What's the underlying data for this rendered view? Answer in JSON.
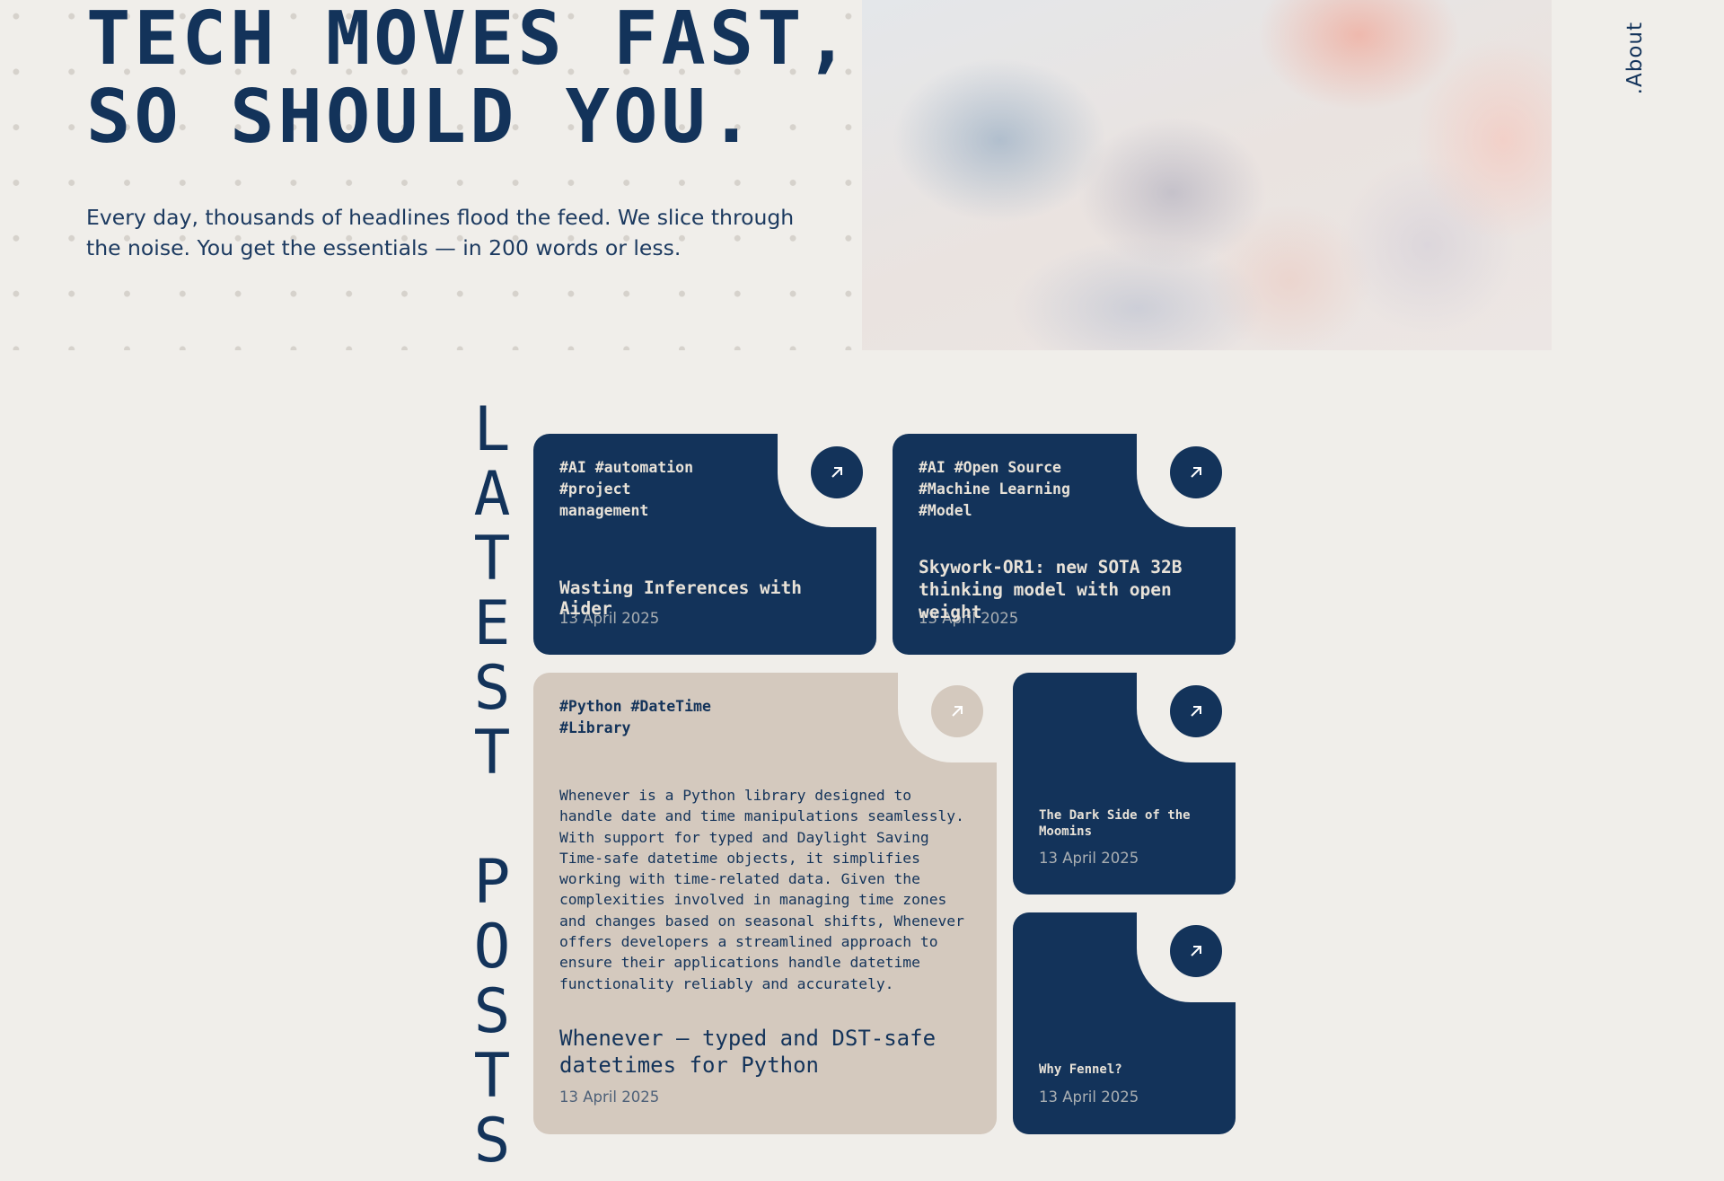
{
  "hero": {
    "title_line1": "TECH MOVES FAST,",
    "title_line2": "SO SHOULD YOU.",
    "subtitle": "Every day, thousands of headlines flood the feed. We slice through the noise. You get the essentials — in 200 words or less."
  },
  "nav": {
    "about_label": ".About"
  },
  "section": {
    "label_latest": [
      "L",
      "A",
      "T",
      "E",
      "S",
      "T"
    ],
    "label_posts": [
      "P",
      "O",
      "S",
      "T",
      "S"
    ]
  },
  "posts": [
    {
      "tags": "#AI #automation #project management",
      "title": "Wasting Inferences with Aider",
      "date": "13 April 2025"
    },
    {
      "tags": "#AI #Open Source #Machine Learning #Model",
      "title": "Skywork-OR1: new SOTA 32B thinking model with open weight",
      "date": "13 April 2025"
    },
    {
      "tags": "#Python #DateTime #Library",
      "excerpt": "Whenever is a Python library designed to handle date and time manipulations seamlessly. With support for typed and Daylight Saving Time-safe datetime objects, it simplifies working with time-related data. Given the complexities involved in managing time zones and changes based on seasonal shifts, Whenever offers developers a streamlined approach to ensure their applications handle datetime functionality reliably and accurately.",
      "title": "Whenever – typed and DST-safe datetimes for Python",
      "date": "13 April 2025"
    },
    {
      "title": "The Dark Side of the Moomins",
      "date": "13 April 2025"
    },
    {
      "title": "Why Fennel?",
      "date": "13 April 2025"
    }
  ],
  "colors": {
    "navy": "#13335a",
    "beige": "#d4c9be",
    "background": "#f0eeea"
  },
  "icons": {
    "card_link": "arrow-up-right-icon"
  }
}
